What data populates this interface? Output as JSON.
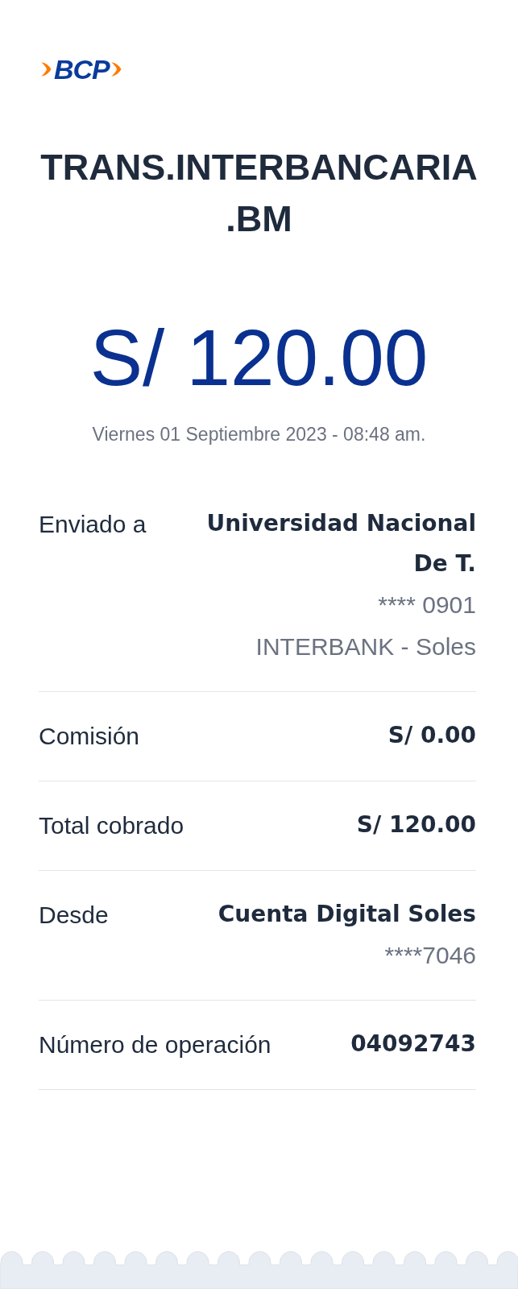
{
  "logo": {
    "text": "BCP"
  },
  "title": "TRANS.INTERBANCARIA .BM",
  "amount": "S/ 120.00",
  "date": "Viernes 01 Septiembre 2023 - 08:48 am.",
  "details": [
    {
      "label": "Enviado a",
      "value": "Universidad Nacional De T.",
      "extra": [
        "**** 0901",
        "INTERBANK - Soles"
      ]
    },
    {
      "label": "Comisión",
      "value": "S/ 0.00"
    },
    {
      "label": "Total cobrado",
      "value": "S/ 120.00"
    },
    {
      "label": "Desde",
      "value": "Cuenta Digital Soles",
      "extra": [
        "****7046"
      ]
    },
    {
      "label": "Número de operación",
      "value": "04092743"
    }
  ]
}
